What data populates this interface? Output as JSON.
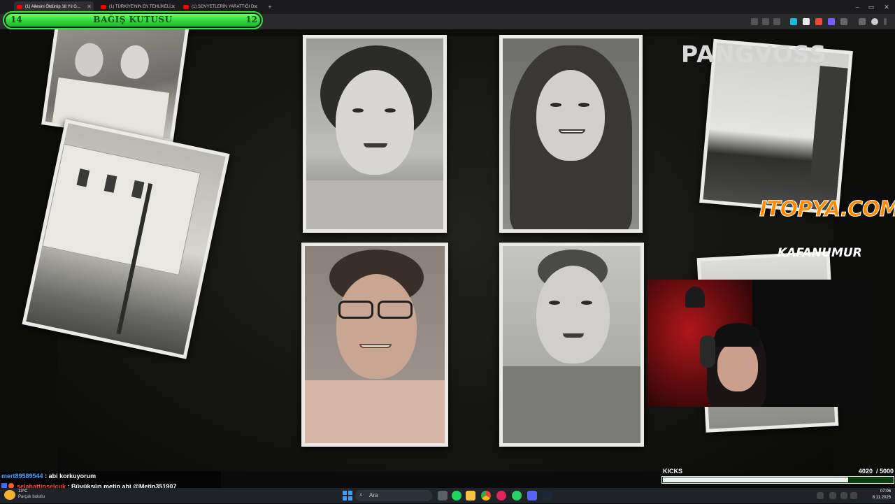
{
  "browser": {
    "tabs": [
      {
        "label": "(1) Ailesini Öldürüp 18 Yıl G...",
        "active": true
      },
      {
        "label": "(1) TÜRKİYE'NİN EN TEHLİKELİ...",
        "active": false
      },
      {
        "label": "(1) SOVYETLERİN YARATTIĞI D...",
        "active": false
      }
    ],
    "new_tab": "+",
    "minimize": "–",
    "maximize": "▭",
    "close": "✕"
  },
  "donation": {
    "left_value": "14",
    "title": "BAĞIŞ KUTUSU",
    "right_value": "12"
  },
  "video": {
    "watermark_channel": "PANGVOSS",
    "sponsor_1": "ITOPYA.COM",
    "sponsor_2": "KAFANUMUR"
  },
  "chat": [
    {
      "user": "mert89589544",
      "message": "abi korkuyorum",
      "user_color": "#4da3ff"
    },
    {
      "user": "selahattinselcuk",
      "message": "Büyüksün metin abi @Metin351907",
      "user_color": "#ff3b3b"
    }
  ],
  "weather": {
    "temp": "13°C",
    "desc": "Parçalı bulutlu"
  },
  "kicks": {
    "label": "KICKS",
    "current": "4020",
    "goal": "/ 5000",
    "progress": 0.804
  },
  "taskbar": {
    "search_placeholder": "Ara",
    "time": "07:06",
    "date": "8.11.2025"
  },
  "colors": {
    "donation_green": "#2dd43a",
    "sponsor_orange": "#ff8a00",
    "youtube_red": "#ff0000"
  }
}
